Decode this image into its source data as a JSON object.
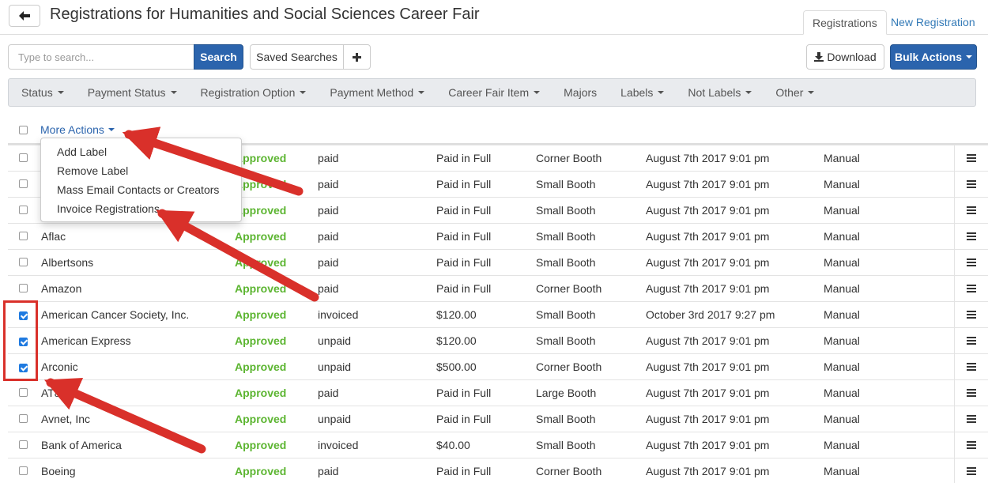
{
  "header": {
    "title": "Registrations for Humanities and Social Sciences Career Fair",
    "tabs": [
      "Registrations",
      "New Registration"
    ]
  },
  "toolbar": {
    "search_placeholder": "Type to search...",
    "search_label": "Search",
    "saved_searches_label": "Saved Searches",
    "add_icon": "plus-icon",
    "download_label": "Download",
    "bulk_actions_label": "Bulk Actions"
  },
  "filters": [
    "Status",
    "Payment Status",
    "Registration Option",
    "Payment Method",
    "Career Fair Item",
    "Majors",
    "Labels",
    "Not Labels",
    "Other"
  ],
  "more_actions": {
    "label": "More Actions",
    "items": [
      "Add Label",
      "Remove Label",
      "Mass Email Contacts or Creators",
      "Invoice Registrations"
    ]
  },
  "rows": [
    {
      "name": "",
      "status": "Approved",
      "payment": "paid",
      "amount": "Paid in Full",
      "item": "Corner Booth",
      "date": "August 7th 2017 9:01 pm",
      "method": "Manual",
      "checked": false
    },
    {
      "name": "",
      "status": "Approved",
      "payment": "paid",
      "amount": "Paid in Full",
      "item": "Small Booth",
      "date": "August 7th 2017 9:01 pm",
      "method": "Manual",
      "checked": false
    },
    {
      "name": "",
      "status": "Approved",
      "payment": "paid",
      "amount": "Paid in Full",
      "item": "Small Booth",
      "date": "August 7th 2017 9:01 pm",
      "method": "Manual",
      "checked": false
    },
    {
      "name": "Aflac",
      "status": "Approved",
      "payment": "paid",
      "amount": "Paid in Full",
      "item": "Small Booth",
      "date": "August 7th 2017 9:01 pm",
      "method": "Manual",
      "checked": false
    },
    {
      "name": "Albertsons",
      "status": "Approved",
      "payment": "paid",
      "amount": "Paid in Full",
      "item": "Small Booth",
      "date": "August 7th 2017 9:01 pm",
      "method": "Manual",
      "checked": false
    },
    {
      "name": "Amazon",
      "status": "Approved",
      "payment": "paid",
      "amount": "Paid in Full",
      "item": "Corner Booth",
      "date": "August 7th 2017 9:01 pm",
      "method": "Manual",
      "checked": false
    },
    {
      "name": "American Cancer Society, Inc.",
      "status": "Approved",
      "payment": "invoiced",
      "amount": "$120.00",
      "item": "Small Booth",
      "date": "October 3rd 2017 9:27 pm",
      "method": "Manual",
      "checked": true
    },
    {
      "name": "American Express",
      "status": "Approved",
      "payment": "unpaid",
      "amount": "$120.00",
      "item": "Small Booth",
      "date": "August 7th 2017 9:01 pm",
      "method": "Manual",
      "checked": true
    },
    {
      "name": "Arconic",
      "status": "Approved",
      "payment": "unpaid",
      "amount": "$500.00",
      "item": "Corner Booth",
      "date": "August 7th 2017 9:01 pm",
      "method": "Manual",
      "checked": true
    },
    {
      "name": "AT&T",
      "status": "Approved",
      "payment": "paid",
      "amount": "Paid in Full",
      "item": "Large Booth",
      "date": "August 7th 2017 9:01 pm",
      "method": "Manual",
      "checked": false
    },
    {
      "name": "Avnet, Inc",
      "status": "Approved",
      "payment": "unpaid",
      "amount": "Paid in Full",
      "item": "Small Booth",
      "date": "August 7th 2017 9:01 pm",
      "method": "Manual",
      "checked": false
    },
    {
      "name": "Bank of America",
      "status": "Approved",
      "payment": "invoiced",
      "amount": "$40.00",
      "item": "Small Booth",
      "date": "August 7th 2017 9:01 pm",
      "method": "Manual",
      "checked": false
    },
    {
      "name": "Boeing",
      "status": "Approved",
      "payment": "paid",
      "amount": "Paid in Full",
      "item": "Corner Booth",
      "date": "August 7th 2017 9:01 pm",
      "method": "Manual",
      "checked": false
    }
  ],
  "colors": {
    "primary": "#2b64ad",
    "approved": "#5cb531",
    "annotation": "#d9302a",
    "checkbox_checked": "#1f7ae0"
  }
}
